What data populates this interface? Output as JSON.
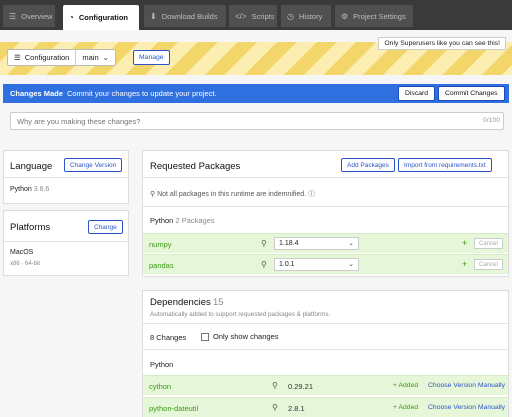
{
  "tabs": [
    {
      "label": "Overview",
      "icon": "list-icon"
    },
    {
      "label": "Configuration",
      "icon": "config-icon",
      "active": true
    },
    {
      "label": "Download Builds",
      "icon": "download-icon"
    },
    {
      "label": "Scripts",
      "icon": "code-icon"
    },
    {
      "label": "History",
      "icon": "clock-icon"
    },
    {
      "label": "Project Settings",
      "icon": "gear-icon"
    }
  ],
  "banner": {
    "superuser_note": "Only Superusers like you can see this!",
    "config_label": "Configuration",
    "branch": "main",
    "manage_label": "Manage"
  },
  "changes": {
    "title": "Changes Made",
    "message": "Commit your changes to update your project.",
    "discard_label": "Discard",
    "commit_label": "Commit Changes",
    "placeholder": "Why are you making these changes?",
    "counter": "0/100"
  },
  "language": {
    "title": "Language",
    "change_version_label": "Change Version",
    "name": "Python",
    "version": "3.6.6"
  },
  "platforms": {
    "title": "Platforms",
    "change_label": "Change",
    "os": "MacOS",
    "os_version": "x86 · 64-bit"
  },
  "requested": {
    "title": "Requested Packages",
    "add_label": "Add Packages",
    "import_label": "Import from requirements.txt",
    "notice": "Not all packages in this runtime are indemnified.",
    "group_name": "Python",
    "group_count": "2 Packages",
    "packages": [
      {
        "name": "numpy",
        "version": "1.18.4",
        "cancel": "Cancel"
      },
      {
        "name": "pandas",
        "version": "1.0.1",
        "cancel": "Cancel"
      }
    ]
  },
  "dependencies": {
    "title": "Dependencies",
    "count": "15",
    "subtitle": "Automatically added to support requested packages & platforms.",
    "changes_count": "8 Changes",
    "only_show_label": "Only show changes",
    "group_name": "Python",
    "items": [
      {
        "name": "cython",
        "version": "0.29.21",
        "status": "+ Added",
        "action": "Choose Version Manually"
      },
      {
        "name": "python-dateutil",
        "version": "2.8.1",
        "status": "+ Added",
        "action": "Choose Version Manually"
      }
    ]
  },
  "colors": {
    "accent": "#2f6fe0",
    "added_green": "#3c9a18",
    "added_bg": "#e6f6d8",
    "stripe_yellow": "#f3d66a"
  }
}
